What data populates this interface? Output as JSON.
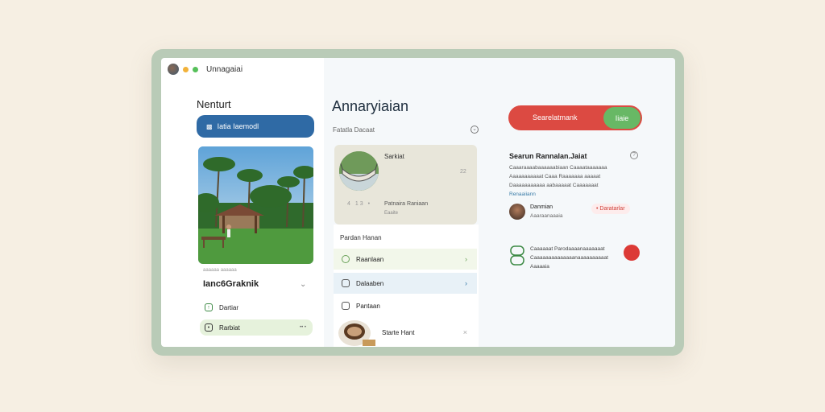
{
  "window": {
    "title": "Unnagaiai"
  },
  "left": {
    "heading": "Nenturt",
    "primary_button": "Iatia Iaemodl",
    "section_caption": "aaaaaa aaaaaa",
    "section_title": "Ianc6Graknik",
    "rows": [
      {
        "label": "Dartiar",
        "meta": ""
      },
      {
        "label": "Rarbiat",
        "meta": "•• •"
      }
    ]
  },
  "middle": {
    "title": "Annaryiaian",
    "subtitle": "Fatatla Dacaat",
    "card": {
      "name": "Sarkiat",
      "count": "22",
      "stats": "4 13 •",
      "status": "Patnaira Raniaan",
      "sub": "Eaaite"
    },
    "list_title": "Pardan Hanan",
    "rows": [
      {
        "label": "Raanlaan",
        "action": "›"
      },
      {
        "label": "Dalaaben",
        "action": "›"
      },
      {
        "label": "Pantaan",
        "action": ""
      },
      {
        "label": "Starte Hant",
        "action": "×"
      }
    ]
  },
  "right": {
    "toggle_label": "Searelatmank",
    "toggle_knob": "Iiaie",
    "panel_title": "Searun Rannalan.Jaiat",
    "panel_desc": "Caaaraaaabaaaaaabiaan Caaaataaaaaaa Aaaaaaaaaaat Caaa Raaaaaaa aaaaat Daaaaaaaaaaa aabaaaaat Caaaaaaat",
    "panel_link": "Renaaiiann",
    "person": {
      "name": "Danmian",
      "role": "Aaaraanaaaia",
      "tag": "Daratarlar"
    },
    "notice": "Caaaaaat Parodaaaanaaaaaaat Caaaaaaaaaaaaaanaaaaaaaaaat Aaaaaia"
  }
}
